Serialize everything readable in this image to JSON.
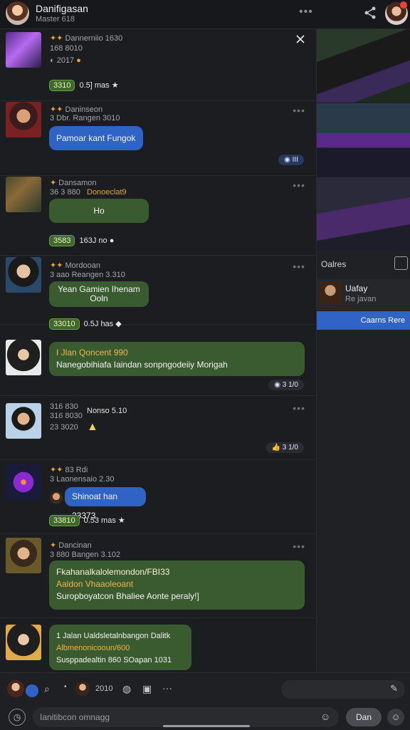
{
  "header": {
    "title": "Danifigasan",
    "subtitle": "Master 618",
    "more_icon": "more-dots-icon",
    "share_icon": "share-icon"
  },
  "posts": [
    {
      "meta1": "Dannerniio 1630",
      "meta2": "168 8010",
      "meta3": "2017",
      "chips": [
        "3310"
      ],
      "chip_text": "0.5] mas"
    },
    {
      "meta1": "Daninseon",
      "meta2": "3 Dbr. Rangen 3010",
      "bubble": "Pamoar kant Fungok",
      "badge": "III"
    },
    {
      "meta1": "Dansamon",
      "meta2": "36 3 880",
      "tag": "Donoeclat9",
      "bubble": "Ho",
      "chips": [
        "3583"
      ],
      "chip_text": "163J no"
    },
    {
      "meta1": "Mordooan",
      "meta2": "3 aao Reangen 3.310",
      "bubble": "Yean Gamien Ihenam Ooln",
      "chips": [
        "33010"
      ],
      "chip_text": "0.5J has"
    },
    {
      "bubble_line1": "I Jlan Qoncent 990",
      "bubble_line2": "Nanegobihiafa Iaindan sonpngodeiiy Morigah",
      "badge": "3 1/0"
    },
    {
      "meta1": "316 830",
      "meta2": "316 8030",
      "meta3": "23 3020",
      "tag": "Nonso 5.10",
      "badge": "3 1/0"
    },
    {
      "meta1": "83 Rdi",
      "meta2": "3 Laonensaio 2.30",
      "bubble": "Shinoat han 23373"
    },
    {
      "meta1": "Dancinan",
      "meta2": "3 880 Bangen 3.102",
      "chips": [
        "33810"
      ],
      "chip_text": "0.53 mas"
    },
    {
      "bubble_line1": "Fkahanalkalolemondon/FBI33",
      "bubble_line2": "Aaldon Vhaaoleoant",
      "bubble_line3": "Suropboyatcon Bhaliee Aonte peraly!]"
    },
    {
      "bubble_line1": "1 Jalan Ualdsletalnbangon Dalitk",
      "bubble_line2": "Albmenonicooun/600",
      "bubble_line3": "Susppadealtin 860 SOapan 1031"
    }
  ],
  "sidebar": {
    "heading": "Oalres",
    "friend_name": "Uafay",
    "friend_sub": "Re javan",
    "button": "Caarns Rere"
  },
  "toolbar": {
    "count": "2010",
    "composer_placeholder": "Ianitibcon omnagg",
    "send_label": "Dan"
  },
  "colors": {
    "accent_blue": "#2f63c6",
    "bubble_green": "#3a5a2f",
    "chip_green": "#3d6a2a",
    "background": "#1c1d20"
  }
}
